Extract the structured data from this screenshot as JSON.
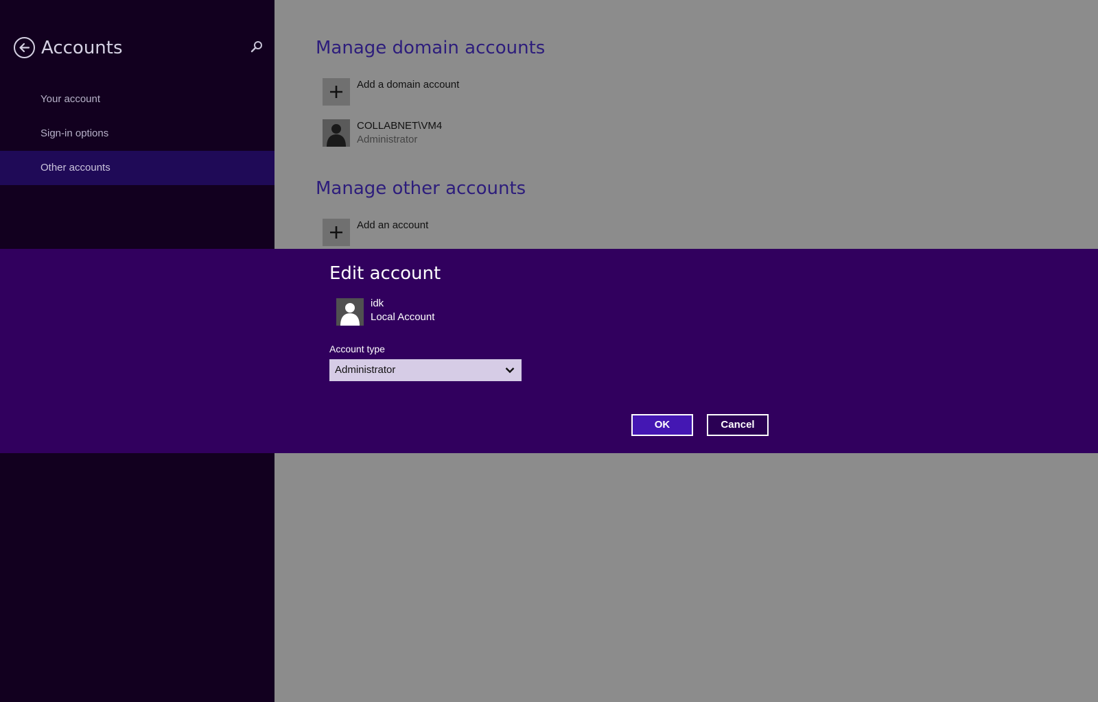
{
  "sidebar": {
    "title": "Accounts",
    "back_icon": "back-arrow-icon",
    "search_icon": "search-icon",
    "items": [
      {
        "label": "Your account"
      },
      {
        "label": "Sign-in options"
      },
      {
        "label": "Other accounts",
        "active": true
      }
    ]
  },
  "main": {
    "domain_section": {
      "title": "Manage domain accounts",
      "add_label": "Add a domain account",
      "account": {
        "name": "COLLABNET\\VM4",
        "type": "Administrator"
      }
    },
    "other_section": {
      "title": "Manage other accounts",
      "add_label": "Add an account"
    }
  },
  "modal": {
    "title": "Edit account",
    "user": {
      "name": "idk",
      "type": "Local Account"
    },
    "account_type_label": "Account type",
    "account_type_value": "Administrator",
    "ok_label": "OK",
    "cancel_label": "Cancel"
  },
  "colors": {
    "sidebar_bg": "#12001f",
    "sidebar_active": "#1f0a57",
    "main_bg": "#8c8c8c",
    "section_title": "#2d1d7c",
    "modal_bg": "#31005e",
    "ok_button": "#4417b3"
  }
}
